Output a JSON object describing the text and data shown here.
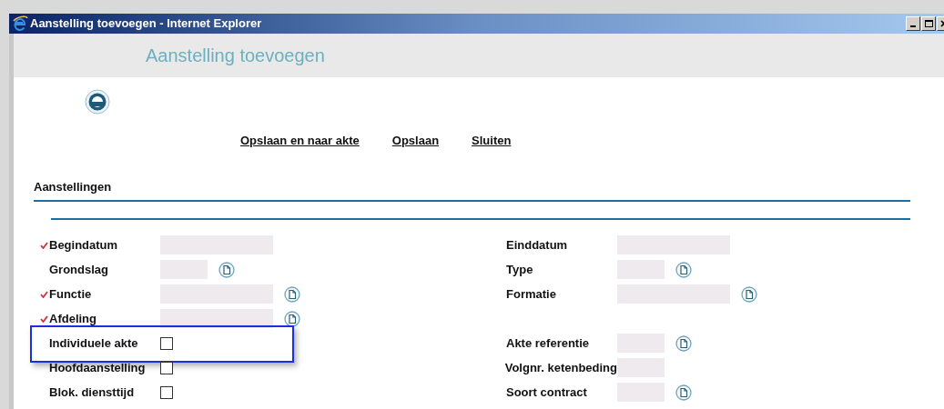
{
  "window": {
    "title": "Aanstelling toevoegen - Internet Explorer"
  },
  "page": {
    "heading": "Aanstelling toevoegen"
  },
  "actions": [
    "Opslaan en naar akte",
    "Opslaan",
    "Sluiten"
  ],
  "section": {
    "title": "Aanstellingen"
  },
  "rows": [
    {
      "left": {
        "label": "Begindatum",
        "required": true,
        "kind": "widefield",
        "lookup": false
      },
      "right": {
        "label": "Einddatum",
        "required": false,
        "kind": "widefield",
        "lookup": false
      }
    },
    {
      "left": {
        "label": "Grondslag",
        "required": false,
        "kind": "narrowfield",
        "lookup": true
      },
      "right": {
        "label": "Type",
        "required": false,
        "kind": "narrowfield",
        "lookup": true
      }
    },
    {
      "left": {
        "label": "Functie",
        "required": true,
        "kind": "widefield",
        "lookup": true
      },
      "right": {
        "label": "Formatie",
        "required": false,
        "kind": "widefield",
        "lookup": true
      }
    },
    {
      "left": {
        "label": "Afdeling",
        "required": true,
        "kind": "widefield",
        "lookup": true
      }
    },
    {
      "left": {
        "label": "Individuele akte",
        "required": false,
        "kind": "checkbox",
        "checked": false,
        "highlighted": true
      },
      "right": {
        "label": "Akte referentie",
        "required": false,
        "kind": "narrowfield",
        "lookup": true
      }
    },
    {
      "left": {
        "label": "Hoofdaanstelling",
        "required": false,
        "kind": "checkbox",
        "checked": false,
        "highlighted": false
      },
      "right": {
        "label": "Volgnr. ketenbeding",
        "required": false,
        "kind": "narrowfield",
        "lookup": false
      }
    },
    {
      "left": {
        "label": "Blok. diensttijd",
        "required": false,
        "kind": "checkbox",
        "checked": false,
        "highlighted": false
      },
      "right": {
        "label": "Soort contract",
        "required": false,
        "kind": "narrowfield",
        "lookup": true
      }
    }
  ]
}
